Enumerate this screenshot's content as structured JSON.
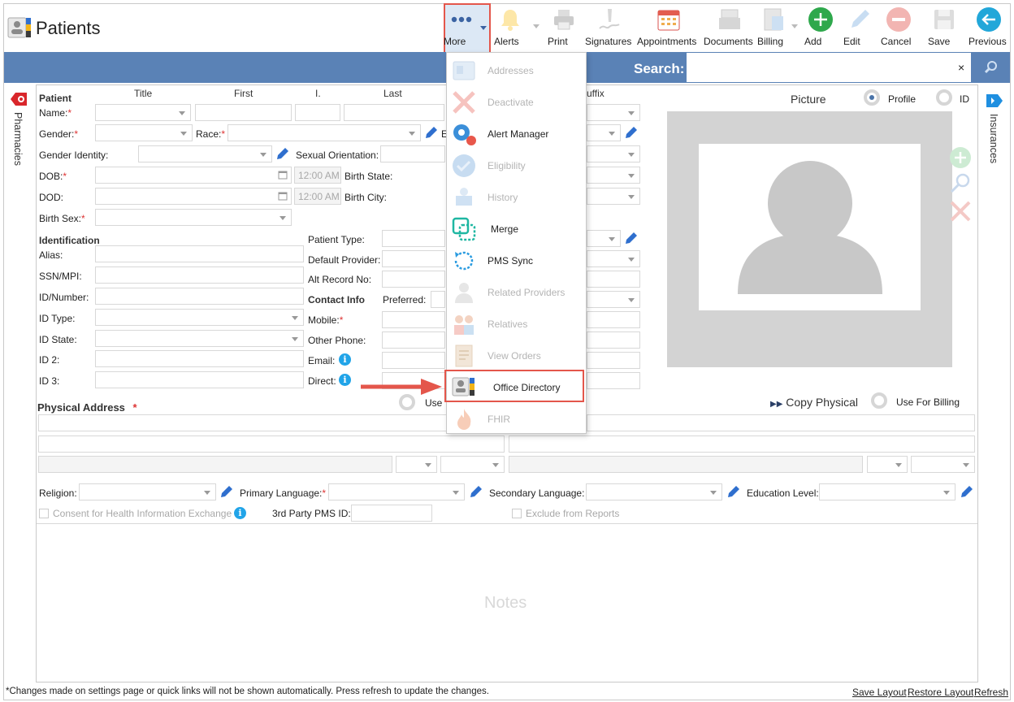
{
  "header": {
    "title": "Patients"
  },
  "toolbar": {
    "more": "More",
    "alerts": "Alerts",
    "print": "Print",
    "signatures": "Signatures",
    "appointments": "Appointments",
    "documents": "Documents",
    "billing": "Billing",
    "add": "Add",
    "edit": "Edit",
    "cancel": "Cancel",
    "save": "Save",
    "previous": "Previous"
  },
  "search": {
    "label": "Search:",
    "clear": "×"
  },
  "side": {
    "left": "Pharmacies",
    "right": "Insurances"
  },
  "patient": {
    "section": "Patient",
    "col_title": "Title",
    "col_first": "First",
    "col_initial": "I.",
    "col_last": "Last",
    "col_suffix": "uffix",
    "name": "Name:",
    "gender": "Gender:",
    "race": "Race:",
    "ethnicity_initial": "E",
    "gender_identity": "Gender Identity:",
    "sexual_orientation": "Sexual Orientation:",
    "dob": "DOB:",
    "dod": "DOD:",
    "time_placeholder": "12:00 AM",
    "birth_state": "Birth State:",
    "birth_city": "Birth City:",
    "birth_sex": "Birth Sex:"
  },
  "identification": {
    "section": "Identification",
    "alias": "Alias:",
    "ssn": "SSN/MPI:",
    "id_number": "ID/Number:",
    "id_type": "ID Type:",
    "id_state": "ID State:",
    "id2": "ID 2:",
    "id3": "ID 3:",
    "patient_type": "Patient Type:",
    "default_provider": "Default Provider:",
    "alt_record": "Alt Record No:"
  },
  "contact": {
    "section": "Contact Info",
    "preferred": "Preferred:",
    "mobile": "Mobile:",
    "other_phone": "Other Phone:",
    "email": "Email:",
    "direct": "Direct:",
    "use_prefix": "Use"
  },
  "picture": {
    "label": "Picture",
    "profile": "Profile",
    "id": "ID"
  },
  "address": {
    "title": "Physical Address",
    "copy": "Copy Physical",
    "use_billing": "Use For Billing"
  },
  "misc": {
    "religion": "Religion:",
    "primary_language": "Primary Language:",
    "secondary_language": "Secondary Language:",
    "education": "Education Level:",
    "consent": "Consent for Health Information Exchange",
    "third_party": "3rd Party PMS ID:",
    "exclude": "Exclude from Reports",
    "notes": "Notes"
  },
  "menu": {
    "items": [
      {
        "label": "Addresses",
        "icon": "addresses-icon",
        "enabled": false
      },
      {
        "label": "Deactivate",
        "icon": "deactivate-icon",
        "enabled": false
      },
      {
        "label": "Alert Manager",
        "icon": "alert-manager-icon",
        "enabled": true
      },
      {
        "label": "Eligibility",
        "icon": "eligibility-icon",
        "enabled": false
      },
      {
        "label": "History",
        "icon": "history-icon",
        "enabled": false
      },
      {
        "label": "Merge",
        "icon": "merge-icon",
        "enabled": true
      },
      {
        "label": "PMS Sync",
        "icon": "pms-sync-icon",
        "enabled": true
      },
      {
        "label": "Related Providers",
        "icon": "related-providers-icon",
        "enabled": false
      },
      {
        "label": "Relatives",
        "icon": "relatives-icon",
        "enabled": false
      },
      {
        "label": "View Orders",
        "icon": "view-orders-icon",
        "enabled": false
      },
      {
        "label": "Office Directory",
        "icon": "office-directory-icon",
        "enabled": true
      },
      {
        "label": "FHIR",
        "icon": "fhir-icon",
        "enabled": false
      }
    ]
  },
  "footer": {
    "note": "*Changes made on settings page or quick links will not be shown automatically. Press refresh to update the changes.",
    "save_layout": "Save Layout",
    "restore_layout": "Restore Layout",
    "refresh": "Refresh"
  },
  "colors": {
    "bar": "#5a82b6",
    "highlight": "#e4564b",
    "required": "#d33",
    "info": "#21a4e8"
  }
}
